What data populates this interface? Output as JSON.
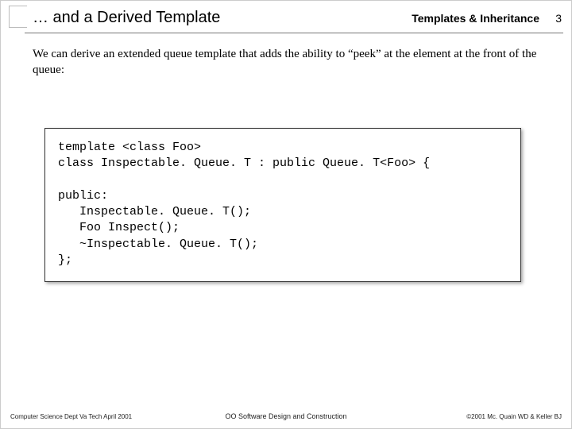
{
  "header": {
    "title": "… and a Derived Template",
    "chapter": "Templates & Inheritance",
    "page": "3"
  },
  "intro": "We can derive an extended queue template that adds the ability to “peek” at the element at the front of the queue:",
  "code": "template <class Foo>\nclass Inspectable. Queue. T : public Queue. T<Foo> {\n\npublic:\n   Inspectable. Queue. T();\n   Foo Inspect();\n   ~Inspectable. Queue. T();\n};",
  "footer": {
    "left": "Computer Science Dept Va Tech April 2001",
    "center": "OO Software Design and Construction",
    "right": "©2001 Mc. Quain WD & Keller BJ"
  }
}
